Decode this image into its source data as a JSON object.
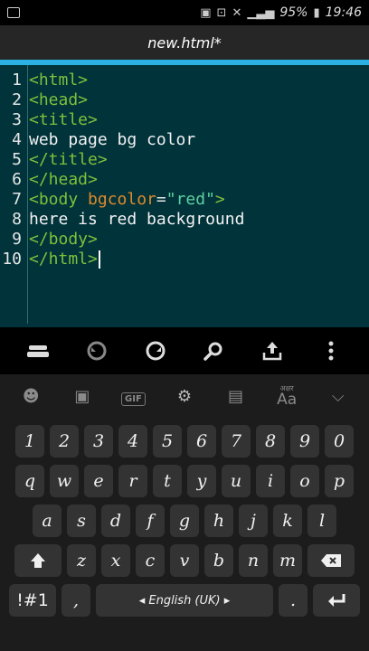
{
  "status_bar": {
    "battery_percent": "95%",
    "time": "19:46",
    "icons": [
      "image-icon",
      "signal-icon",
      "cast-icon",
      "mute-icon",
      "cellular-icon",
      "battery-icon"
    ]
  },
  "title": "new.html*",
  "colors": {
    "accent": "#2bb1e3",
    "editor_bg": "#00333a",
    "tag": "#7ec03b",
    "attribute": "#e08a2b",
    "string": "#5fd0a0"
  },
  "editor": {
    "lines": [
      {
        "num": "1",
        "segments": [
          {
            "t": "<html>",
            "c": "tag"
          }
        ]
      },
      {
        "num": "2",
        "segments": [
          {
            "t": "<head>",
            "c": "tag"
          }
        ]
      },
      {
        "num": "3",
        "segments": [
          {
            "t": "<title>",
            "c": "tag"
          }
        ]
      },
      {
        "num": "4",
        "segments": [
          {
            "t": "web page bg color",
            "c": "txt"
          }
        ]
      },
      {
        "num": "5",
        "segments": [
          {
            "t": "</title>",
            "c": "tag"
          }
        ]
      },
      {
        "num": "6",
        "segments": [
          {
            "t": "</head>",
            "c": "tag"
          }
        ]
      },
      {
        "num": "7",
        "segments": [
          {
            "t": "<body ",
            "c": "tag"
          },
          {
            "t": "bgcolor",
            "c": "attr"
          },
          {
            "t": "=",
            "c": "eq"
          },
          {
            "t": "\"red\"",
            "c": "str"
          },
          {
            "t": ">",
            "c": "tag"
          }
        ]
      },
      {
        "num": "8",
        "segments": [
          {
            "t": "here is red background",
            "c": "txt"
          }
        ]
      },
      {
        "num": "9",
        "segments": [
          {
            "t": "</body>",
            "c": "tag"
          }
        ]
      },
      {
        "num": "10",
        "segments": [
          {
            "t": "</html>",
            "c": "tag"
          }
        ]
      }
    ]
  },
  "toolbar": {
    "icons": [
      "keyboard-toggle-icon",
      "undo-icon",
      "redo-icon",
      "search-icon",
      "share-icon",
      "more-icon"
    ]
  },
  "keyboard": {
    "top_row_icons": [
      "emoji-icon",
      "sticker-icon",
      "gif-icon",
      "settings-icon",
      "clipboard-icon",
      "font-style-icon",
      "collapse-icon"
    ],
    "gif_label": "GIF",
    "aa_small": "अक्षर",
    "aa_label": "Aa",
    "row_numbers": [
      "1",
      "2",
      "3",
      "4",
      "5",
      "6",
      "7",
      "8",
      "9",
      "0"
    ],
    "row_q": [
      "q",
      "w",
      "e",
      "r",
      "t",
      "y",
      "u",
      "i",
      "o",
      "p"
    ],
    "row_a": [
      "a",
      "s",
      "d",
      "f",
      "g",
      "h",
      "j",
      "k",
      "l"
    ],
    "row_z": [
      "z",
      "x",
      "c",
      "v",
      "b",
      "n",
      "m"
    ],
    "symbols_label": "!#1",
    "comma_label": ",",
    "space_label": "◂ English (UK) ▸",
    "period_label": "."
  }
}
